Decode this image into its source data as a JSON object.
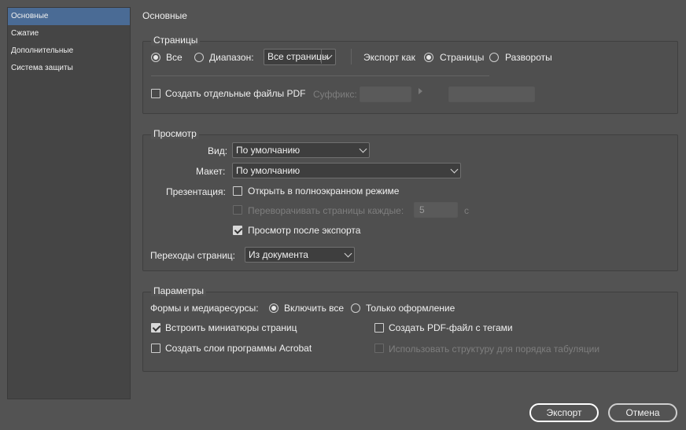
{
  "sidebar": {
    "items": [
      {
        "label": "Основные",
        "active": true
      },
      {
        "label": "Сжатие",
        "active": false
      },
      {
        "label": "Дополнительные",
        "active": false
      },
      {
        "label": "Система защиты",
        "active": false
      }
    ]
  },
  "page_title": "Основные",
  "pages": {
    "title": "Страницы",
    "all_label": "Все",
    "range_label": "Диапазон:",
    "range_value": "Все страницы",
    "export_as_label": "Экспорт как",
    "pages_option": "Страницы",
    "spreads_option": "Развороты",
    "separate_pdf_label": "Создать отдельные файлы PDF",
    "suffix_label": "Суффикс:"
  },
  "view": {
    "title": "Просмотр",
    "view_label": "Вид:",
    "view_value": "По умолчанию",
    "layout_label": "Макет:",
    "layout_value": "По умолчанию",
    "presentation_label": "Презентация:",
    "fullscreen_label": "Открыть в полноэкранном режиме",
    "flip_label": "Переворачивать страницы каждые:",
    "flip_value": "5",
    "flip_unit": "с",
    "preview_label": "Просмотр после экспорта",
    "transitions_label": "Переходы страниц:",
    "transitions_value": "Из документа"
  },
  "options": {
    "title": "Параметры",
    "forms_label": "Формы и медиаресурсы:",
    "include_all": "Включить все",
    "appearance_only": "Только оформление",
    "thumbnails_label": "Встроить миниатюры страниц",
    "tagged_pdf_label": "Создать PDF-файл с тегами",
    "acrobat_layers_label": "Создать слои программы Acrobat",
    "structure_tab_label": "Использовать структуру для порядка табуляции"
  },
  "buttons": {
    "export": "Экспорт",
    "cancel": "Отмена"
  }
}
